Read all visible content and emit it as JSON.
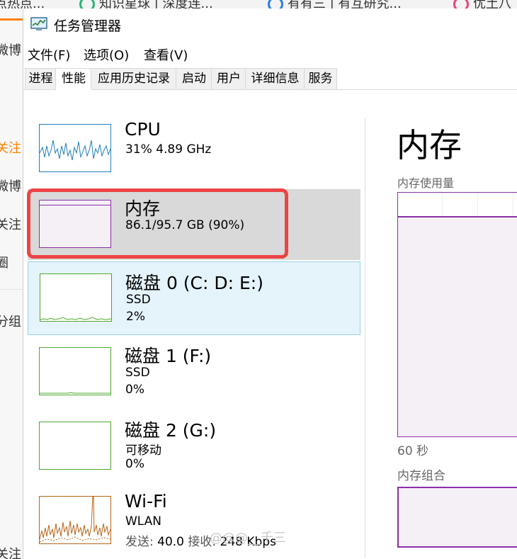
{
  "background": {
    "tabs": [
      "点热点...",
      "知识星球 | 深度连...",
      "有有三 | 有互研究...",
      "优土八"
    ],
    "left_items": [
      "微博",
      "关注",
      "微博",
      "关注",
      "圈",
      "分组",
      "关注"
    ]
  },
  "window": {
    "title": "任务管理器",
    "icon": "task-manager-icon"
  },
  "menu": [
    "文件(F)",
    "选项(O)",
    "查看(V)"
  ],
  "tabs": [
    "进程",
    "性能",
    "应用历史记录",
    "启动",
    "用户",
    "详细信息",
    "服务"
  ],
  "active_tab": "性能",
  "resources": [
    {
      "name": "CPU",
      "line1": "31%  4.89 GHz",
      "line2": "",
      "color": "#1f7fb8"
    },
    {
      "name": "内存",
      "line1": "86.1/95.7 GB (90%)",
      "line2": "",
      "color": "#8b2fa8",
      "usage": 0.9
    },
    {
      "name": "磁盘 0 (C: D: E:)",
      "line1": "SSD",
      "line2": "2%",
      "color": "#4ea72e"
    },
    {
      "name": "磁盘 1 (F:)",
      "line1": "SSD",
      "line2": "0%",
      "color": "#4ea72e"
    },
    {
      "name": "磁盘 2 (G:)",
      "line1": "可移动",
      "line2": "0%",
      "color": "#4ea72e"
    },
    {
      "name": "Wi-Fi",
      "line1": "WLAN",
      "send_label": "发送:",
      "send_value": "40.0",
      "recv_label": "接收:",
      "recv_value": "248 Kbps",
      "color": "#b8651a"
    }
  ],
  "detail": {
    "title": "内存",
    "usage_label": "内存使用量",
    "time_label": "60 秒",
    "composition_label": "内存组合",
    "usage_fraction": 0.9
  },
  "watermark": "@@@__千三"
}
